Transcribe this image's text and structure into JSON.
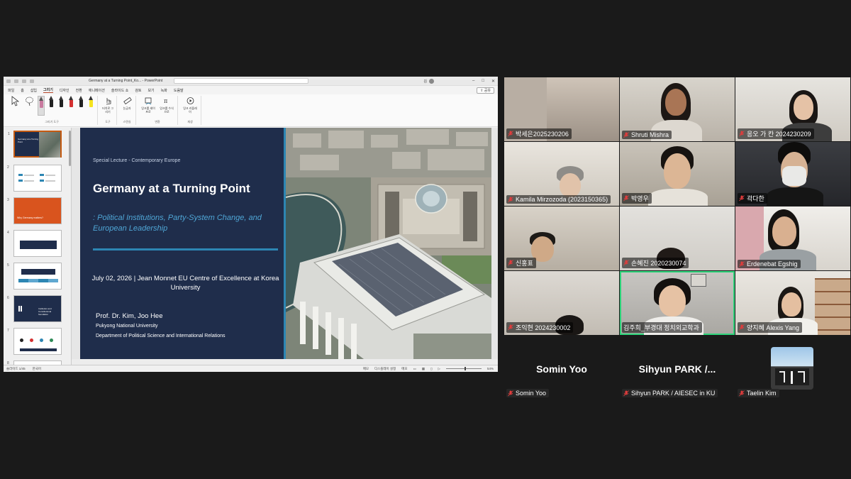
{
  "ppt": {
    "window_title": "Germany at a Turning Point_Ko... - PowerPoint",
    "user_initial": "김",
    "tabs": [
      "파일",
      "홈",
      "삽입",
      "그리기",
      "디자인",
      "전환",
      "애니메이션",
      "슬라이드 쇼",
      "검토",
      "보기",
      "녹화",
      "도움말"
    ],
    "active_tab": "그리기",
    "share_label": "공유",
    "ribbon_groups": [
      {
        "label": "그리기 도구"
      },
      {
        "label": "도구",
        "buttons": [
          "터치로 그리기"
        ]
      },
      {
        "label": "스텐실",
        "buttons": [
          "눈금자"
        ]
      },
      {
        "label": "변환",
        "buttons": [
          "잉크를 셰이프로",
          "잉크를 수식으로"
        ]
      },
      {
        "label": "재생",
        "buttons": [
          "잉크 리플레이"
        ]
      }
    ],
    "pen_colors": [
      "#222222",
      "#222222",
      "#d43131",
      "#222222",
      "#f5e31f"
    ],
    "slide_numbers": [
      "1",
      "2",
      "3",
      "4",
      "5",
      "6",
      "7",
      "8"
    ],
    "thumb_texts": {
      "t1": "Germany at a Turning Point",
      "t3": "Why Germany matters?",
      "t6": "Institution and Constitutional foundation"
    },
    "status_left": [
      "슬라이드 1/45",
      "한국어"
    ],
    "status_right": [
      "메모",
      "디스플레이 설정",
      "메모",
      "54%"
    ]
  },
  "slide": {
    "kicker": "Special  Lecture - Contemporary Europe",
    "title": "Germany at a Turning Point",
    "subtitle": ": Political Institutions, Party-System Change, and European Leadership",
    "date_line": "July 02, 2026 | Jean Monnet EU Centre of Excellence at Korea University",
    "prof": "Prof. Dr. Kim, Joo Hee",
    "university": "Pukyong National University",
    "department": "Department of Political Science and International Relations"
  },
  "gallery": {
    "tiles": [
      {
        "name": "박세은2025230206"
      },
      {
        "name": "Shruti Mishra"
      },
      {
        "name": "응오 가 칸 2024230209"
      },
      {
        "name": "Kamila Mirzozoda (2023150365)"
      },
      {
        "name": "박영우"
      },
      {
        "name": "곽다한"
      },
      {
        "name": "신홍표"
      },
      {
        "name": "손혜진 2020230074"
      },
      {
        "name": "Erdenebat Egshig"
      },
      {
        "name": "조익현 2024230002"
      },
      {
        "name": "김주희_부경대 정치외교학과"
      },
      {
        "name": "양지혜 Alexis Yang"
      }
    ],
    "no_video": [
      {
        "display": "Somin Yoo",
        "label": "Somin Yoo"
      },
      {
        "display": "Sihyun  PARK  /...",
        "label": "Sihyun PARK / AIESEC in KU"
      },
      {
        "display": "",
        "label": "Taelin Kim"
      }
    ]
  }
}
